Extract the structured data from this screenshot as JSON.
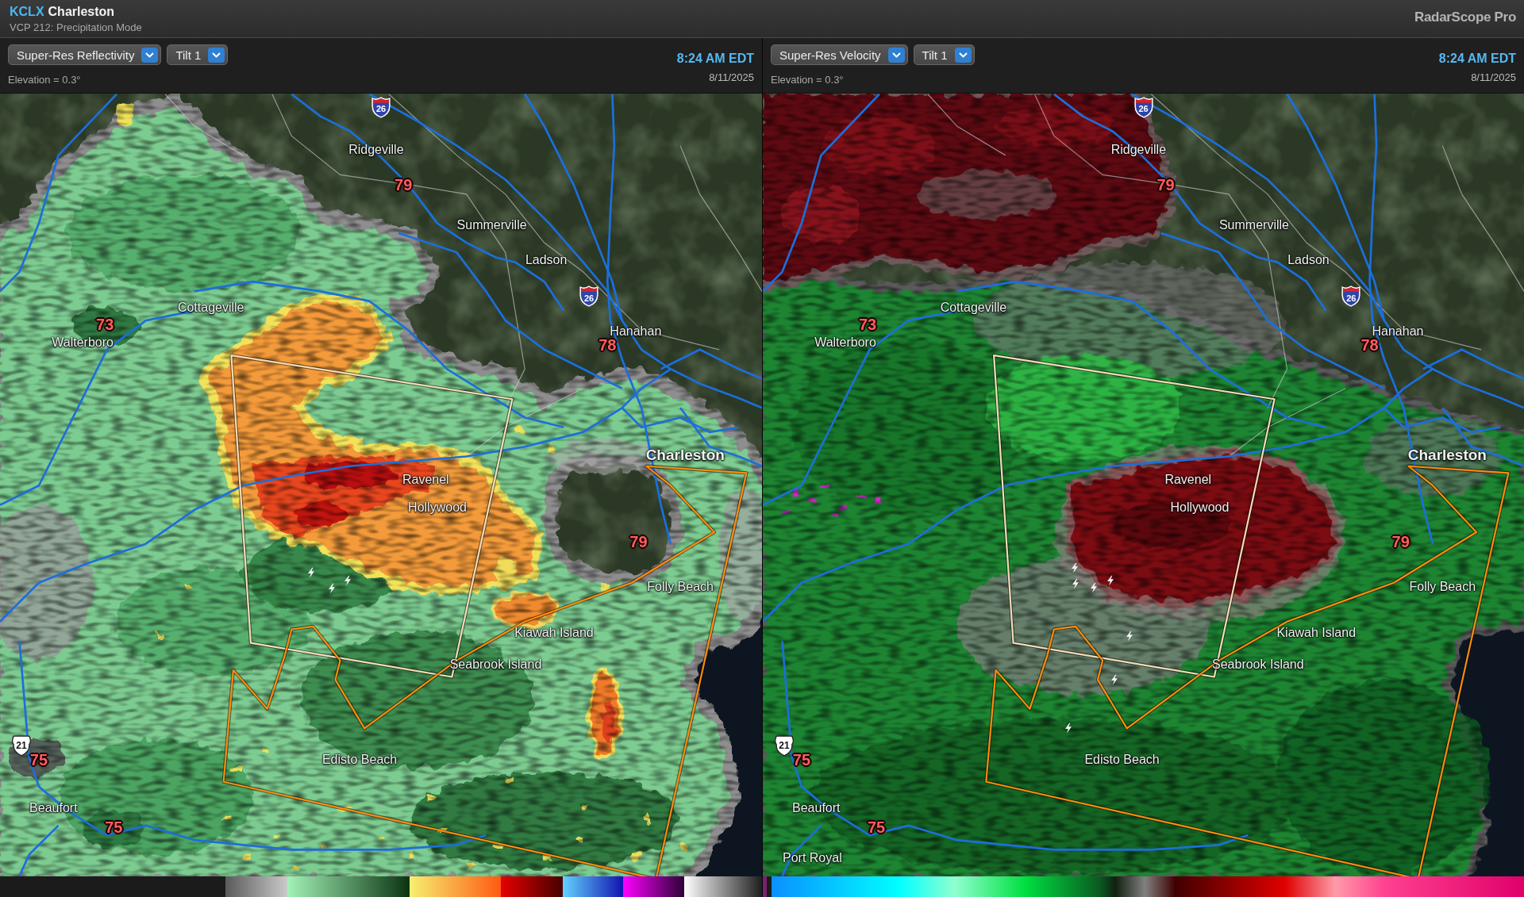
{
  "window": {
    "station_code": "KCLX",
    "station_name": "Charleston",
    "mode": "VCP 212: Precipitation Mode",
    "app_name": "RadarScope Pro"
  },
  "panels": [
    {
      "kind": "reflectivity",
      "product": "Super-Res Reflectivity",
      "tilt": "Tilt 1",
      "elevation": "Elevation = 0.3°",
      "time": "8:24 AM EDT",
      "date": "8/11/2025",
      "map_labels": [
        {
          "kind": "interstate",
          "text": "26"
        },
        {
          "kind": "city",
          "text": "Ridgeville"
        },
        {
          "kind": "temperature",
          "text": "79"
        },
        {
          "kind": "city",
          "text": "Summerville"
        },
        {
          "kind": "city",
          "text": "Ladson"
        },
        {
          "kind": "interstate",
          "text": "26"
        },
        {
          "kind": "city",
          "text": "Hanahan"
        },
        {
          "kind": "temperature",
          "text": "78"
        },
        {
          "kind": "temperature",
          "text": "73"
        },
        {
          "kind": "city",
          "text": "Walterboro"
        },
        {
          "kind": "city",
          "text": "Cottageville"
        },
        {
          "kind": "major_city",
          "text": "Charleston"
        },
        {
          "kind": "city",
          "text": "Ravenel"
        },
        {
          "kind": "city",
          "text": "Hollywood"
        },
        {
          "kind": "temperature",
          "text": "79"
        },
        {
          "kind": "city",
          "text": "Folly Beach"
        },
        {
          "kind": "city",
          "text": "Kiawah Island"
        },
        {
          "kind": "city",
          "text": "Seabrook Island"
        },
        {
          "kind": "us_route",
          "text": "21"
        },
        {
          "kind": "temperature",
          "text": "75"
        },
        {
          "kind": "city",
          "text": "Edisto Beach"
        },
        {
          "kind": "city",
          "text": "Beaufort"
        },
        {
          "kind": "temperature",
          "text": "75"
        }
      ]
    },
    {
      "kind": "velocity",
      "product": "Super-Res Velocity",
      "tilt": "Tilt 1",
      "elevation": "Elevation = 0.3°",
      "time": "8:24 AM EDT",
      "date": "8/11/2025",
      "map_labels": [
        {
          "kind": "interstate",
          "text": "26"
        },
        {
          "kind": "city",
          "text": "Ridgeville"
        },
        {
          "kind": "temperature",
          "text": "79"
        },
        {
          "kind": "city",
          "text": "Summerville"
        },
        {
          "kind": "city",
          "text": "Ladson"
        },
        {
          "kind": "interstate",
          "text": "26"
        },
        {
          "kind": "city",
          "text": "Hanahan"
        },
        {
          "kind": "temperature",
          "text": "78"
        },
        {
          "kind": "temperature",
          "text": "73"
        },
        {
          "kind": "city",
          "text": "Walterboro"
        },
        {
          "kind": "city",
          "text": "Cottageville"
        },
        {
          "kind": "major_city",
          "text": "Charleston"
        },
        {
          "kind": "city",
          "text": "Ravenel"
        },
        {
          "kind": "city",
          "text": "Hollywood"
        },
        {
          "kind": "temperature",
          "text": "79"
        },
        {
          "kind": "city",
          "text": "Folly Beach"
        },
        {
          "kind": "city",
          "text": "Kiawah Island"
        },
        {
          "kind": "city",
          "text": "Seabrook Island"
        },
        {
          "kind": "us_route",
          "text": "21"
        },
        {
          "kind": "temperature",
          "text": "75"
        },
        {
          "kind": "city",
          "text": "Edisto Beach"
        },
        {
          "kind": "city",
          "text": "Beaufort"
        },
        {
          "kind": "temperature",
          "text": "75"
        },
        {
          "kind": "city",
          "text": "Port Royal"
        }
      ]
    }
  ]
}
